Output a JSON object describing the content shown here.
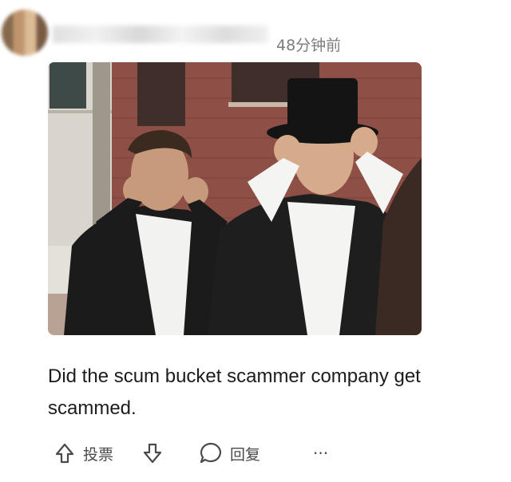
{
  "post": {
    "timestamp": "48分钟前",
    "body": "Did the scum bucket scammer company get scammed."
  },
  "actions": {
    "vote_label": "投票",
    "reply_label": "回复",
    "more_label": "···"
  },
  "colors": {
    "text": "#1c1c1c",
    "muted": "#7c7c7c",
    "icon": "#4a4a4a"
  }
}
